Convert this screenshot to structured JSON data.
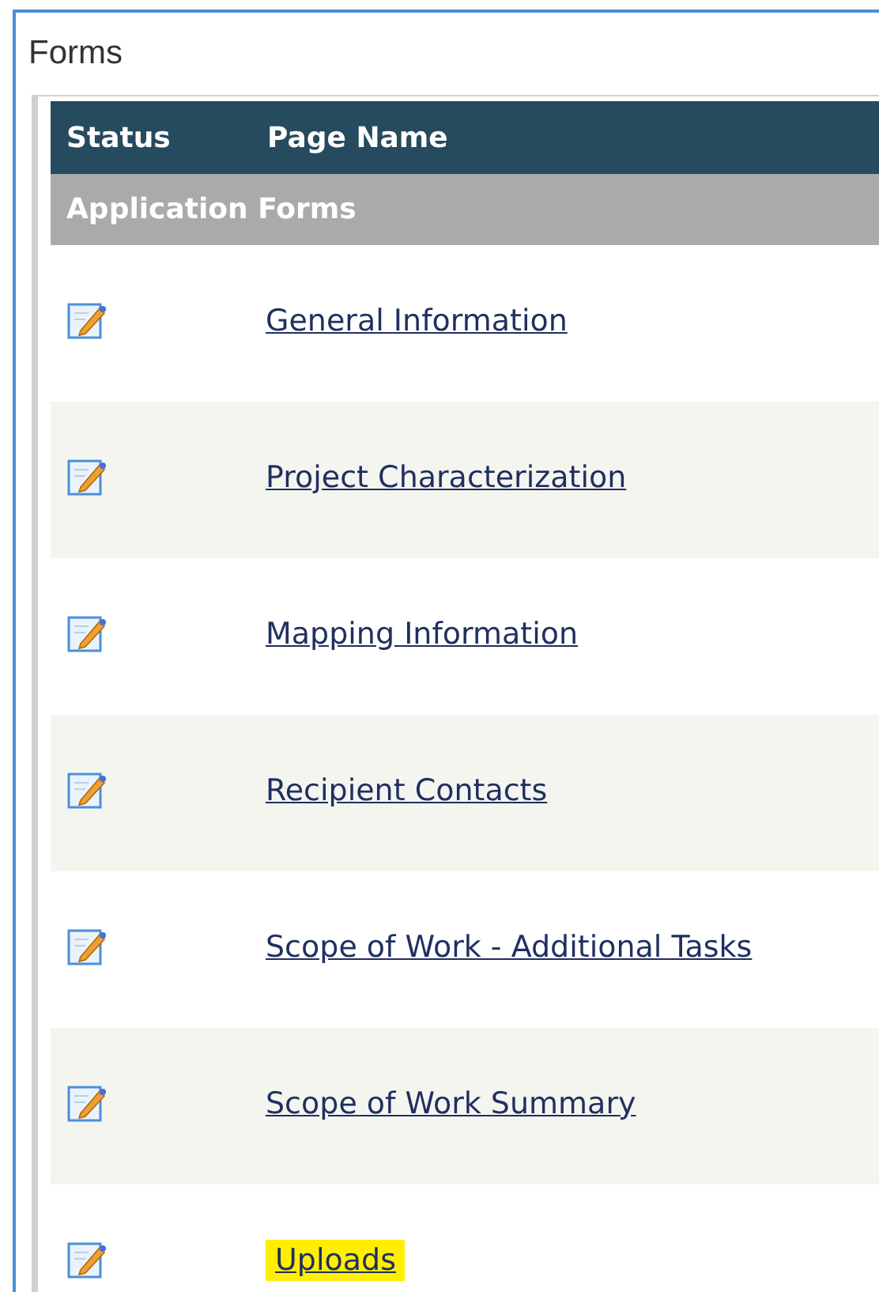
{
  "panel": {
    "title": "Forms"
  },
  "table": {
    "columns": [
      "Status",
      "Page Name"
    ],
    "group": "Application Forms",
    "rows": [
      {
        "page_name": "General Information",
        "highlighted": false
      },
      {
        "page_name": "Project Characterization",
        "highlighted": false
      },
      {
        "page_name": "Mapping Information",
        "highlighted": false
      },
      {
        "page_name": "Recipient Contacts",
        "highlighted": false
      },
      {
        "page_name": "Scope of Work - Additional Tasks",
        "highlighted": false
      },
      {
        "page_name": "Scope of Work Summary",
        "highlighted": false
      },
      {
        "page_name": "Uploads",
        "highlighted": true
      }
    ]
  }
}
